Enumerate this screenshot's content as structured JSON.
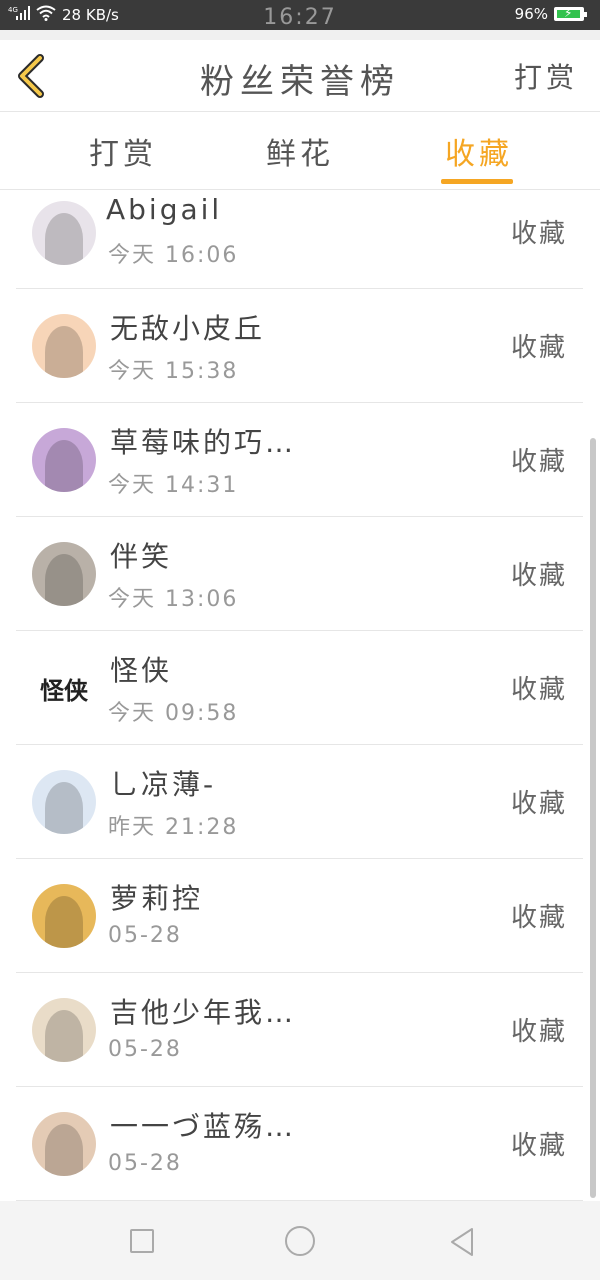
{
  "status_bar": {
    "signal": "4G",
    "network_speed": "28 KB/s",
    "time": "16:27",
    "battery": "96%",
    "battery_level": 0.96
  },
  "header": {
    "title": "粉丝荣誉榜",
    "right_action": "打赏"
  },
  "tabs": [
    {
      "label": "打赏",
      "active": false
    },
    {
      "label": "鲜花",
      "active": false
    },
    {
      "label": "收藏",
      "active": true
    }
  ],
  "fans": [
    {
      "name": "Abigail",
      "time": "今天  16:06",
      "action": "收藏",
      "avatar": "girl-white-hair-avatar",
      "avatar_color": "#e8e3ea"
    },
    {
      "name": "无敌小皮丘",
      "time": "今天  15:38",
      "action": "收藏",
      "avatar": "pikachu-avatar",
      "avatar_color": "#f7d5b8"
    },
    {
      "name": "草莓味的巧…",
      "time": "今天  14:31",
      "action": "收藏",
      "avatar": "anime-girl-purple-avatar",
      "avatar_color": "#c7a8d8"
    },
    {
      "name": "伴笑",
      "time": "今天  13:06",
      "action": "收藏",
      "avatar": "clown-face-avatar",
      "avatar_color": "#b9b1a8"
    },
    {
      "name": "怪侠",
      "time": "今天  09:58",
      "action": "收藏",
      "avatar": "calligraphy-avatar",
      "avatar_color": "#ffffff",
      "avatar_text": "怪侠"
    },
    {
      "name": "乚凉薄-",
      "time": "昨天  21:28",
      "action": "收藏",
      "avatar": "default-z-avatar",
      "avatar_color": "#dde7f3"
    },
    {
      "name": "萝莉控",
      "time": "05-28",
      "action": "收藏",
      "avatar": "anime-group-avatar",
      "avatar_color": "#e7b85a"
    },
    {
      "name": "吉他少年我…",
      "time": "05-28",
      "action": "收藏",
      "avatar": "anime-girl-blonde-avatar",
      "avatar_color": "#e9dcc8"
    },
    {
      "name": "一一づ蓝殇…",
      "time": "05-28",
      "action": "收藏",
      "avatar": "anime-warrior-avatar",
      "avatar_color": "#e4cbb5"
    }
  ]
}
